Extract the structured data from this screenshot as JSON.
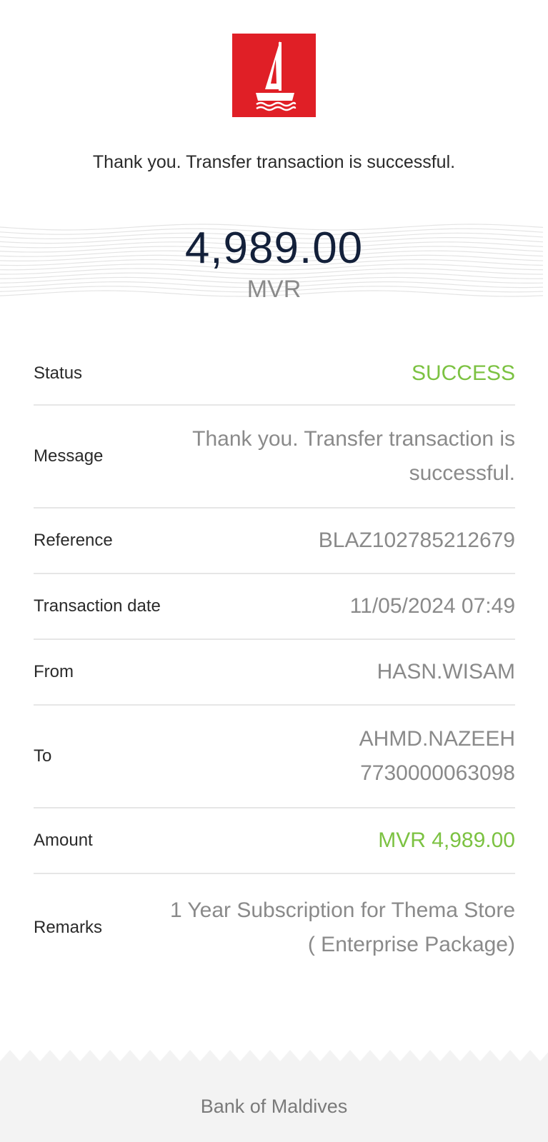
{
  "header": {
    "logo_icon": "boat-sail-icon",
    "message": "Thank you. Transfer transaction is successful."
  },
  "summary": {
    "amount": "4,989.00",
    "currency": "MVR"
  },
  "details": [
    {
      "label": "Status",
      "value": "SUCCESS",
      "highlight": true
    },
    {
      "label": "Message",
      "value": "Thank you. Transfer transaction is successful.",
      "highlight": false
    },
    {
      "label": "Reference",
      "value": "BLAZ102785212679",
      "highlight": false
    },
    {
      "label": "Transaction date",
      "value": "11/05/2024 07:49",
      "highlight": false
    },
    {
      "label": "From",
      "value": "HASN.WISAM",
      "highlight": false
    },
    {
      "label": "To",
      "value": "AHMD.NAZEEH",
      "value2": "7730000063098",
      "highlight": false
    },
    {
      "label": "Amount",
      "value": "MVR 4,989.00",
      "highlight": true
    },
    {
      "label": "Remarks",
      "value": "1 Year Subscription for Thema Store ( Enterprise Package)",
      "highlight": false
    }
  ],
  "footer": {
    "bank_name": "Bank of Maldives"
  },
  "colors": {
    "brand_red": "#e01f26",
    "success_green": "#7cc242",
    "amount_navy": "#13203a",
    "muted_gray": "#8a8a8a"
  }
}
